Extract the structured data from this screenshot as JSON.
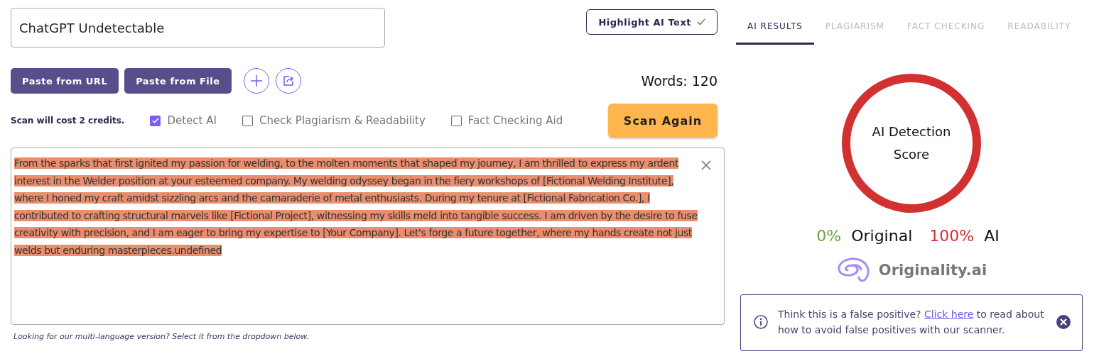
{
  "title_field": {
    "value": "ChatGPT Undetectable"
  },
  "highlight_button": {
    "label": "Highlight AI Text",
    "checked": true
  },
  "tabs": [
    {
      "label": "AI RESULTS",
      "selected": true
    },
    {
      "label": "PLAGIARISM",
      "selected": false
    },
    {
      "label": "FACT CHECKING",
      "selected": false
    },
    {
      "label": "READABILITY",
      "selected": false
    }
  ],
  "paste_buttons": [
    "Paste from URL",
    "Paste from File"
  ],
  "word_count": "Words: 120",
  "cost_note": "Scan will cost 2 credits.",
  "options": [
    {
      "label": "Detect AI",
      "checked": true
    },
    {
      "label": "Check Plagiarism & Readability",
      "checked": false
    },
    {
      "label": "Fact Checking Aid",
      "checked": false
    }
  ],
  "scan_button": "Scan Again",
  "editor": {
    "text": "From the sparks that first ignited my passion for welding, to the molten moments that shaped my journey, I am thrilled to express my ardent interest in the Welder position at your esteemed company. My welding odyssey began in the fiery workshops of [Fictional Welding Institute], where I honed my craft amidst sizzling arcs and the camaraderie of metal enthusiasts. During my tenure at [Fictional Fabrication Co.], I contributed to crafting structural marvels like [Fictional Project], witnessing my skills meld into tangible success. I am driven by the desire to fuse creativity with precision, and I am eager to bring my expertise to [Your Company]. Let's forge a future together, where my hands create not just welds but enduring masterpieces.undefined",
    "highlighted": true
  },
  "language_note": "Looking for our multi-language version? Select it from the dropdown below.",
  "score": {
    "label": "AI Detection Score",
    "original_pct": "0%",
    "original_label": "Original",
    "ai_pct": "100%",
    "ai_label": "AI"
  },
  "logo_text": "Originality.ai",
  "notice": {
    "before": "Think this is a false positive?",
    "link": "Click here",
    "after": "to read about how to avoid false positives with our scanner."
  }
}
